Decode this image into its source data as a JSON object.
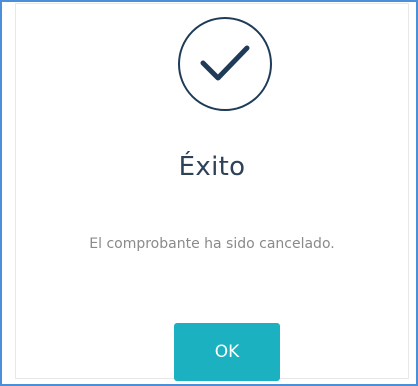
{
  "dialog": {
    "icon": "checkmark-circle-icon",
    "title": "Éxito",
    "message": "El comprobante ha sido cancelado.",
    "ok_label": "OK"
  },
  "colors": {
    "accent": "#1cb1c0",
    "icon_stroke": "#1f3b57",
    "frame_border": "#4a8fd8",
    "title": "#2d4258",
    "message": "#8a8a8a"
  }
}
